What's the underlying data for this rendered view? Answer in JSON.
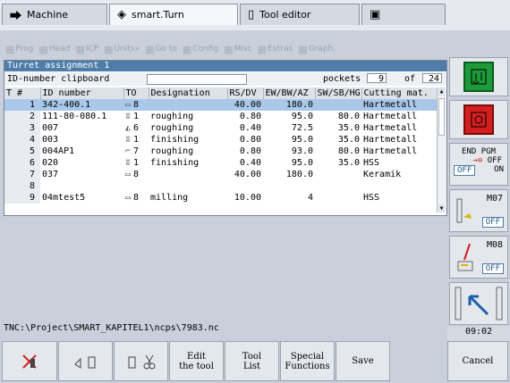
{
  "tabs": [
    {
      "label": "Machine",
      "icon": "arrow-right-icon"
    },
    {
      "label": "smart.Turn",
      "icon": "diamond-arrow-icon"
    },
    {
      "label": "Tool editor",
      "icon": "document-icon"
    },
    {
      "label": "",
      "icon": "save-icon"
    }
  ],
  "menu": [
    "Prog",
    "Head",
    "ICP",
    "Units»",
    "Go to",
    "Config",
    "Misc",
    "Extras",
    "Graph."
  ],
  "panel": {
    "title": "Turret assignment 1",
    "clipboard_label": "ID-number clipboard",
    "clipboard_value": "",
    "pockets_label": "pockets",
    "pockets_value": "9",
    "of_label": "of",
    "of_value": "24"
  },
  "table": {
    "headers": [
      "T #",
      "ID number",
      "TO",
      "Designation",
      "RS/DV",
      "EW/BW/AZ",
      "SW/SB/HG",
      "Cutting mat."
    ],
    "rows": [
      {
        "t": "1",
        "id": "342-400.1",
        "to": "8",
        "desig": "",
        "rs": "40.00",
        "ew": "180.0",
        "sw": "",
        "mat": "Hartmetall",
        "selected": true
      },
      {
        "t": "2",
        "id": "111-80-080.1",
        "to": "1",
        "desig": "roughing",
        "rs": "0.80",
        "ew": "95.0",
        "sw": "80.0",
        "mat": "Hartmetall"
      },
      {
        "t": "3",
        "id": "007",
        "to": "6",
        "desig": "roughing",
        "rs": "0.40",
        "ew": "72.5",
        "sw": "35.0",
        "mat": "Hartmetall"
      },
      {
        "t": "4",
        "id": "003",
        "to": "1",
        "desig": "finishing",
        "rs": "0.80",
        "ew": "95.0",
        "sw": "35.0",
        "mat": "Hartmetall"
      },
      {
        "t": "5",
        "id": "004AP1",
        "to": "7",
        "desig": "roughing",
        "rs": "0.80",
        "ew": "93.0",
        "sw": "80.0",
        "mat": "Hartmetall"
      },
      {
        "t": "6",
        "id": "020",
        "to": "1",
        "desig": "finishing",
        "rs": "0.40",
        "ew": "95.0",
        "sw": "35.0",
        "mat": "HSS"
      },
      {
        "t": "7",
        "id": "037",
        "to": "8",
        "desig": "",
        "rs": "40.00",
        "ew": "180.0",
        "sw": "",
        "mat": "Keramik"
      },
      {
        "t": "8",
        "id": "",
        "to": "",
        "desig": "",
        "rs": "",
        "ew": "",
        "sw": "",
        "mat": ""
      },
      {
        "t": "9",
        "id": "04mtest5",
        "to": "8",
        "desig": "milling",
        "rs": "10.00",
        "ew": "4",
        "sw": "",
        "mat": "HSS"
      }
    ]
  },
  "status_path": "TNC:\\Project\\SMART_KAPITEL1\\ncps\\7983.nc",
  "softkeys": [
    "",
    "",
    "",
    "Edit\nthe tool",
    "Tool\nList",
    "Special\nFunctions",
    "Save"
  ],
  "side": {
    "end_pgm": "END PGM",
    "off": "OFF",
    "on": "ON",
    "m07": "M07",
    "m08": "M08",
    "clock": "09:02",
    "cancel": "Cancel"
  },
  "colors": {
    "accent": "#4d7da8",
    "selected_row": "#a9c8ea",
    "green": "#1e9a3a",
    "red": "#d21f1f"
  }
}
